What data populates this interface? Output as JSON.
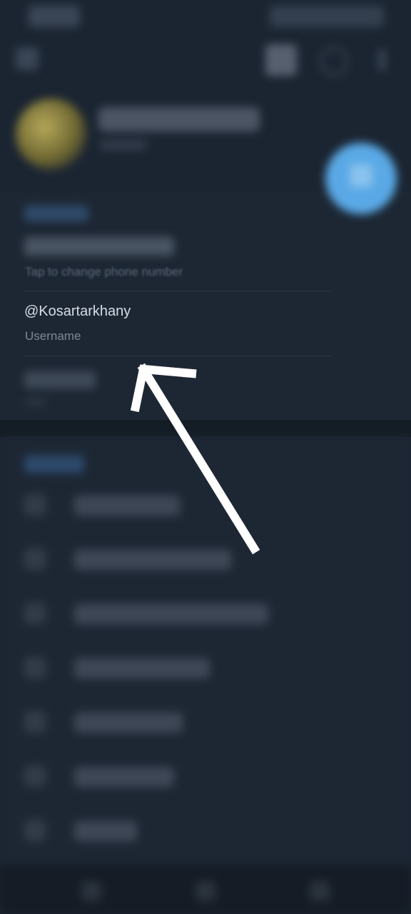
{
  "account": {
    "phone_hint": "Tap to change phone number",
    "username_value": "@Kosartarkhany",
    "username_label": "Username"
  },
  "colors": {
    "background": "#1b2532",
    "accent": "#5aa9e6",
    "arrow": "#ffffff"
  },
  "icons": {
    "menu": "hamburger-icon",
    "qr": "qr-code-icon",
    "search": "search-icon",
    "more": "more-vertical-icon",
    "fab": "camera-icon",
    "annotation": "arrow-annotation"
  }
}
